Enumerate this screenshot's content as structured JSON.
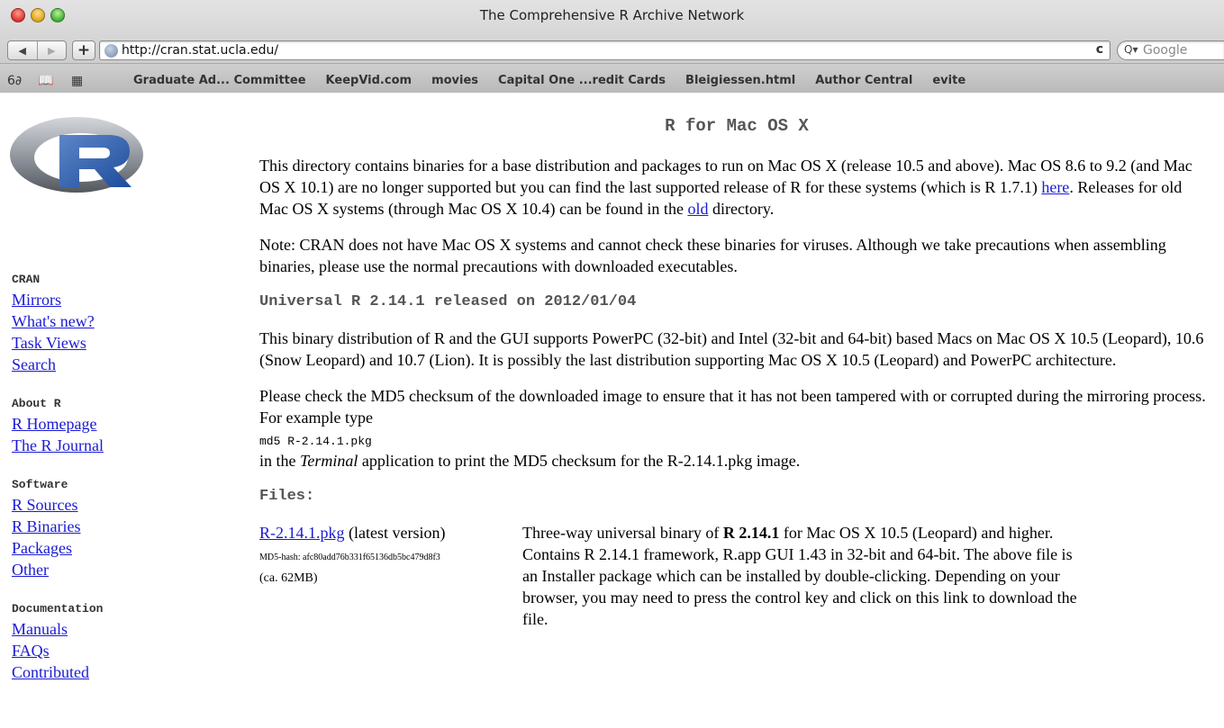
{
  "window": {
    "title": "The Comprehensive R Archive Network"
  },
  "toolbar": {
    "back_icon": "◀",
    "forward_icon": "▶",
    "add_icon": "+",
    "url": "http://cran.stat.ucla.edu/",
    "reload_icon": "c",
    "search_icon": "Q▾",
    "search_placeholder": "Google"
  },
  "bookmarks": {
    "reader_icon": "6∂",
    "book_icon": "📖",
    "grid_icon": "▦",
    "items": [
      "Graduate Ad... Committee",
      "KeepVid.com",
      "movies",
      "Capital One ...redit Cards",
      "Bleigiessen.html",
      "Author Central",
      "evite"
    ]
  },
  "nav": {
    "groups": [
      {
        "heading": "CRAN",
        "links": [
          "Mirrors",
          "What's new?",
          "Task Views",
          "Search"
        ]
      },
      {
        "heading": "About R",
        "links": [
          "R Homepage",
          "The R Journal"
        ]
      },
      {
        "heading": "Software",
        "links": [
          "R Sources",
          "R Binaries",
          "Packages",
          "Other"
        ]
      },
      {
        "heading": "Documentation",
        "links": [
          "Manuals",
          "FAQs",
          "Contributed"
        ]
      }
    ]
  },
  "main": {
    "title": "R for Mac OS X",
    "intro": {
      "text1": "This directory contains binaries for a base distribution and packages to run on Mac OS X (release 10.5 and above). Mac OS 8.6 to 9.2 (and Mac OS X 10.1) are no longer supported but you can find the last supported release of R for these systems (which is R 1.7.1) ",
      "link1": "here",
      "text2": ". Releases for old Mac OS X systems (through Mac OS X 10.4) can be found in the ",
      "link2": "old",
      "text3": " directory."
    },
    "note": "Note: CRAN does not have Mac OS X systems and cannot check these binaries for viruses. Although we take precautions when assembling binaries, please use the normal precautions with downloaded executables.",
    "release_heading": "Universal R 2.14.1 released on 2012/01/04",
    "release_desc": "This binary distribution of R and the GUI supports PowerPC (32-bit) and Intel (32-bit and 64-bit) based Macs on Mac OS X 10.5 (Leopard), 10.6 (Snow Leopard) and 10.7 (Lion). It is possibly the last distribution supporting Mac OS X 10.5 (Leopard) and PowerPC architecture.",
    "checksum": {
      "text1": "Please check the MD5 checksum of the downloaded image to ensure that it has not been tampered with or corrupted during the mirroring process. For example type",
      "code": "md5 R-2.14.1.pkg",
      "text2a": "in the ",
      "text2_italic": "Terminal",
      "text2b": " application to print the MD5 checksum for the R-2.14.1.pkg image."
    },
    "files_heading": "Files:",
    "file": {
      "name": "R-2.14.1.pkg",
      "tag": " (latest version)",
      "md5": "MD5-hash: afc80add76b331f65136db5bc479d8f3",
      "size": "(ca. 62MB)",
      "desc_a": "Three-way universal binary of ",
      "desc_bold": "R 2.14.1",
      "desc_b": " for Mac OS X 10.5 (Leopard) and higher. Contains R 2.14.1 framework, R.app GUI 1.43 in 32-bit and 64-bit. The above file is an Installer package which can be installed by double-clicking. Depending on your browser, you may need to press the control key and click on this link to download the file."
    }
  },
  "colors": {
    "link": "#1a1ad6",
    "heading_gray": "#555555"
  }
}
